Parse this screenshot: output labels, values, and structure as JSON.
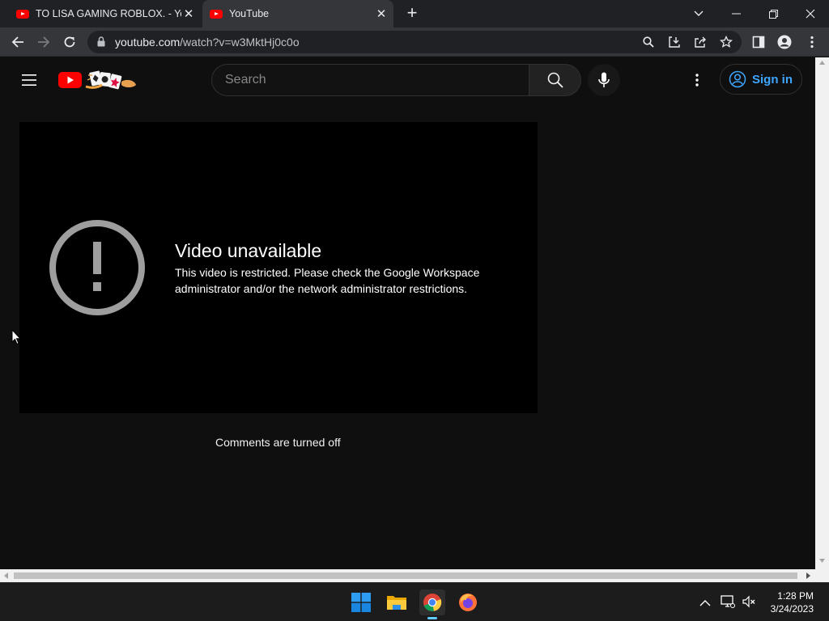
{
  "browser": {
    "tabs": [
      {
        "title": "TO LISA GAMING ROBLOX. - YouTube",
        "active": false
      },
      {
        "title": "YouTube",
        "active": true
      }
    ],
    "new_tab_label": "+",
    "url_host": "youtube.com",
    "url_path": "/watch?v=w3MktHj0c0o"
  },
  "youtube": {
    "search_placeholder": "Search",
    "sign_in_label": "Sign in",
    "error_title": "Video unavailable",
    "error_message": "This video is restricted. Please check the Google Workspace administrator and/or the network administrator restrictions.",
    "comments_text": "Comments are turned off"
  },
  "taskbar": {
    "time": "1:28 PM",
    "date": "3/24/2023",
    "apps": [
      "start-icon",
      "file-explorer-icon",
      "chrome-icon",
      "firefox-icon"
    ]
  },
  "colors": {
    "accent_link": "#3ea6ff",
    "youtube_red": "#ff0000",
    "page_bg": "#0f0f0f"
  }
}
